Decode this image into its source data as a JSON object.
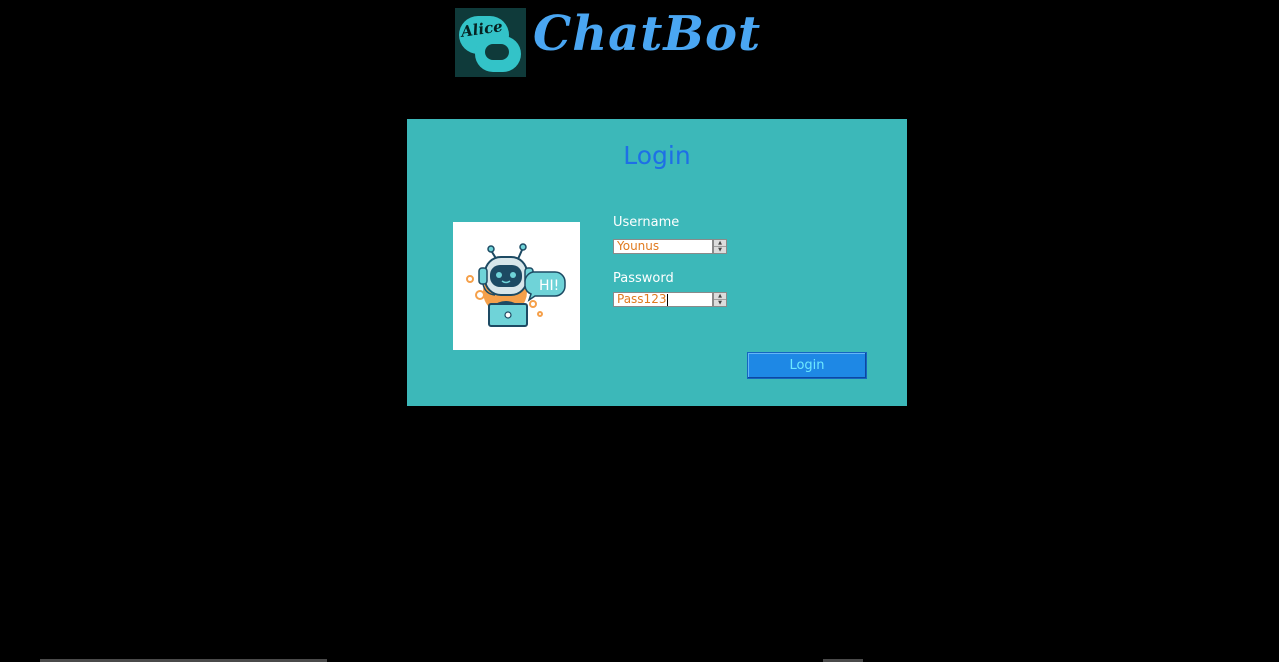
{
  "header": {
    "logo_text": "Alice",
    "app_title": "ChatBot"
  },
  "login_panel": {
    "title": "Login",
    "username_label": "Username",
    "username_value": "Younus",
    "password_label": "Password",
    "password_value": "Pass123",
    "login_button_label": "Login",
    "avatar_speech": "HI!"
  },
  "colors": {
    "background": "#000000",
    "panel": "#3cb8b9",
    "title_blue": "#4aa6f2",
    "login_title": "#1e6fe6",
    "button": "#1e88e5",
    "input_text": "#e07b20"
  },
  "icons": {
    "logo": "chat-bubble-logo-icon",
    "avatar": "robot-headset-icon"
  }
}
